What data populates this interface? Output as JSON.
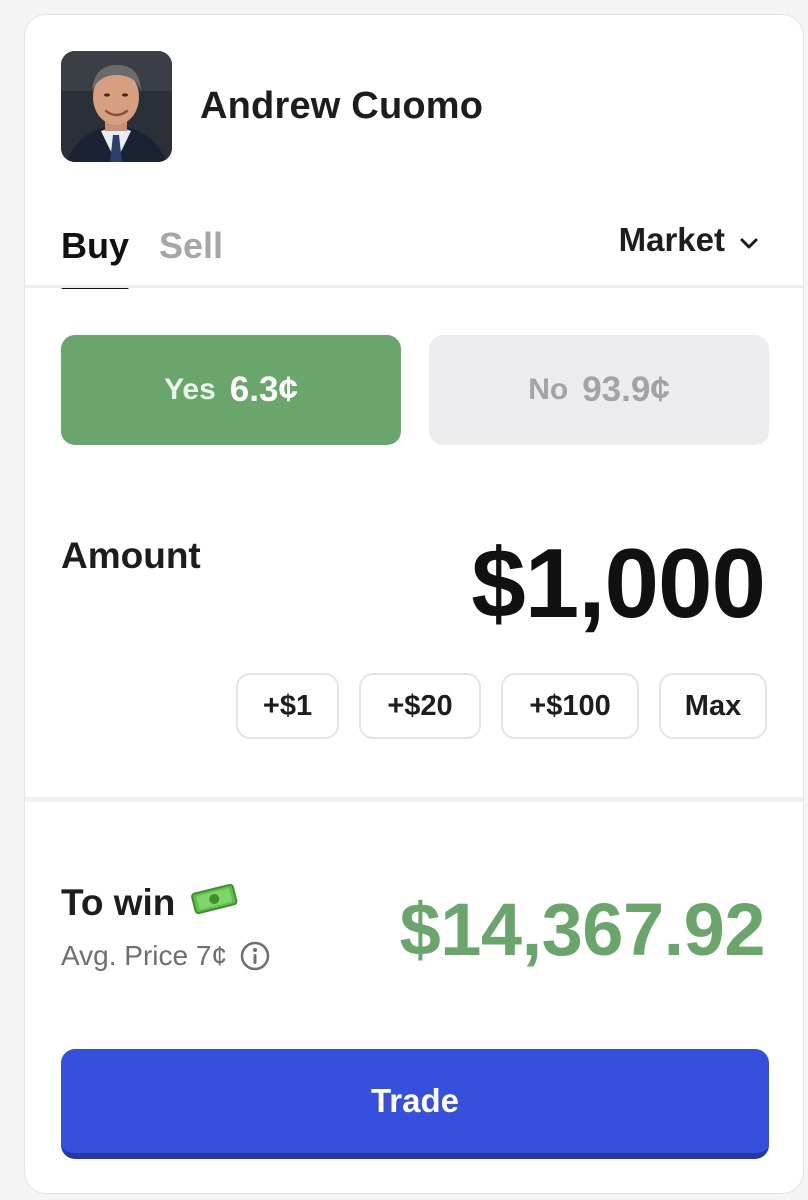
{
  "market": {
    "name": "Andrew Cuomo",
    "avatar_icon": "candidate-portrait"
  },
  "tabs": [
    {
      "label": "Buy",
      "active": true
    },
    {
      "label": "Sell",
      "active": false
    }
  ],
  "order_type": {
    "selected": "Market",
    "icon": "chevron-down-icon"
  },
  "outcomes": [
    {
      "label": "Yes",
      "price": "6.3¢",
      "selected": true,
      "color": "#6aa56c"
    },
    {
      "label": "No",
      "price": "93.9¢",
      "selected": false,
      "color": "#ececee"
    }
  ],
  "amount": {
    "label": "Amount",
    "value": "$1,000"
  },
  "quick_add": [
    "+$1",
    "+$20",
    "+$100",
    "Max"
  ],
  "payout": {
    "label": "To win",
    "icon": "money-bill-icon",
    "avg_price": "Avg. Price 7¢",
    "info_icon": "info-icon",
    "value": "$14,367.92",
    "color": "#6aa56c"
  },
  "trade_button": {
    "label": "Trade",
    "color": "#3450dd"
  }
}
